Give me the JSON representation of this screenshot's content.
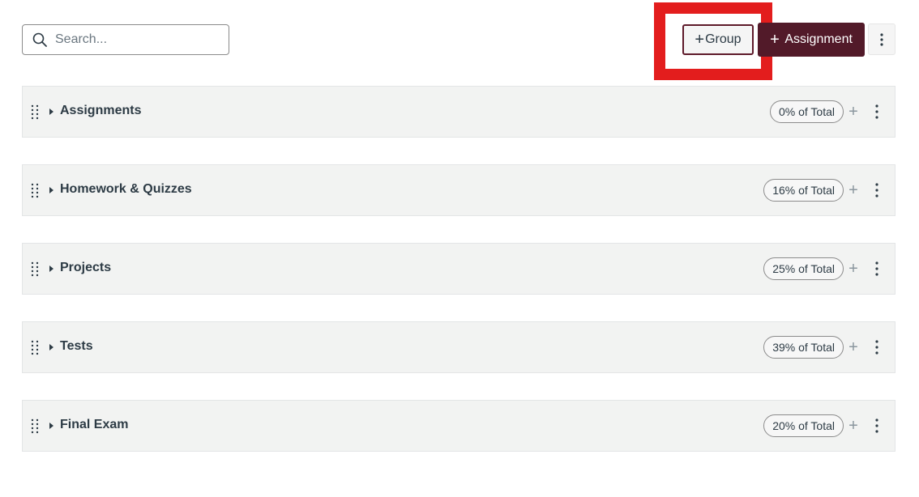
{
  "toolbar": {
    "search_placeholder": "Search...",
    "add_group_label": "Group",
    "add_assignment_label": "Assignment"
  },
  "groups": [
    {
      "name": "Assignments",
      "weight": "0% of Total"
    },
    {
      "name": "Homework & Quizzes",
      "weight": "16% of Total"
    },
    {
      "name": "Projects",
      "weight": "25% of Total"
    },
    {
      "name": "Tests",
      "weight": "39% of Total"
    },
    {
      "name": "Final Exam",
      "weight": "20% of Total"
    }
  ],
  "colors": {
    "primary": "#521a29",
    "highlight": "#e31d1d",
    "row_bg": "#f2f3f2"
  },
  "icons": {
    "search": "search-icon",
    "plus": "plus-icon",
    "more": "kebab-menu-icon",
    "drag": "drag-handle-icon",
    "caret": "caret-right-icon"
  }
}
